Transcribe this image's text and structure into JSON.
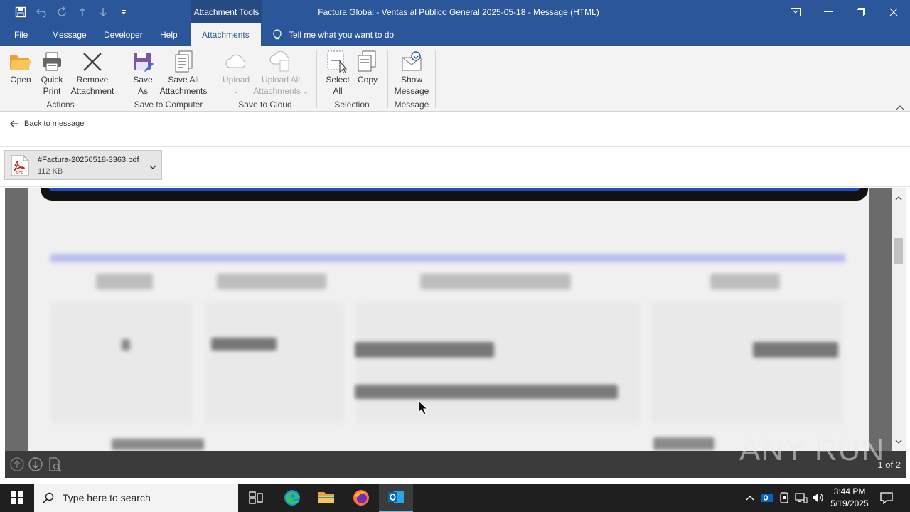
{
  "window": {
    "context_tab": "Attachment Tools",
    "title": "Factura Global - Ventas al Público General 2025-05-18  -  Message (HTML)"
  },
  "menu": {
    "items": [
      "File",
      "Message",
      "Developer",
      "Help",
      "Attachments"
    ],
    "active": "Attachments",
    "tell_me": "Tell me what you want to do"
  },
  "ribbon": {
    "open": "Open",
    "quick_print_1": "Quick",
    "quick_print_2": "Print",
    "remove_1": "Remove",
    "remove_2": "Attachment",
    "group_actions": "Actions",
    "save_as_1": "Save",
    "save_as_2": "As",
    "save_all_1": "Save All",
    "save_all_2": "Attachments",
    "group_save_computer": "Save to Computer",
    "upload": "Upload",
    "upload_all_1": "Upload All",
    "upload_all_2": "Attachments",
    "group_save_cloud": "Save to Cloud",
    "select_all_1": "Select",
    "select_all_2": "All",
    "copy": "Copy",
    "group_selection": "Selection",
    "show_message_1": "Show",
    "show_message_2": "Message",
    "group_message": "Message"
  },
  "back_link": "Back to message",
  "attachment": {
    "name": "#Factura-20250518-3363.pdf",
    "size": "112 KB",
    "icon_label": "PDF"
  },
  "preview": {
    "page_indicator": "1 of 2"
  },
  "watermark": "ANY RUN",
  "taskbar": {
    "search_placeholder": "Type here to search",
    "time": "3:44 PM",
    "date": "5/19/2025"
  },
  "colors": {
    "office_blue": "#2b579a",
    "ribbon_bg": "#f3f3f3",
    "taskbar_bg": "#1f1f1f"
  }
}
